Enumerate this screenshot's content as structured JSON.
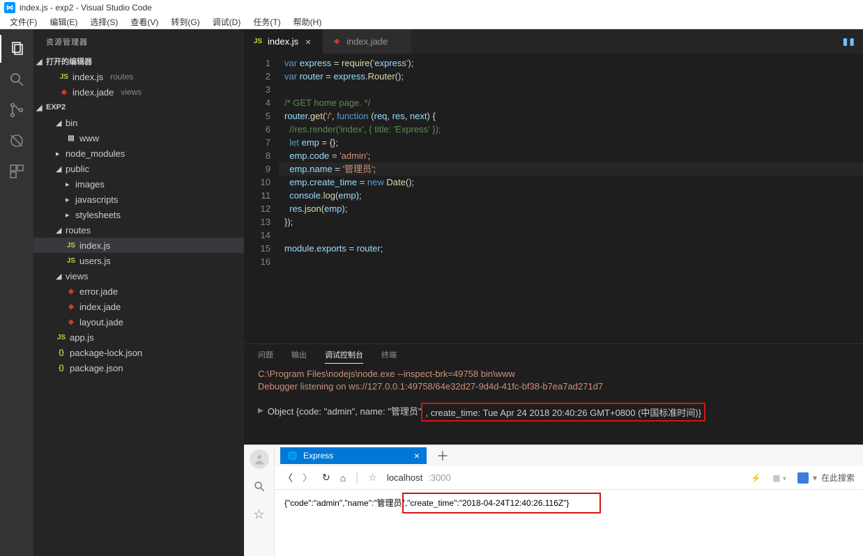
{
  "titlebar": {
    "title": "index.js - exp2 - Visual Studio Code"
  },
  "menubar": {
    "file": "文件(F)",
    "edit": "编辑(E)",
    "selection": "选择(S)",
    "view": "查看(V)",
    "goto": "转到(G)",
    "debug": "调试(D)",
    "tasks": "任务(T)",
    "help": "帮助(H)"
  },
  "sidebar": {
    "title": "资源管理器",
    "openEditorsLabel": "打开的编辑器",
    "openEditors": [
      {
        "name": "index.js",
        "hint": "routes",
        "icon": "JS",
        "iconClass": "js-icon"
      },
      {
        "name": "index.jade",
        "hint": "views",
        "icon": "◆",
        "iconClass": "jade-icon"
      }
    ],
    "projectName": "EXP2",
    "tree": [
      {
        "indent": 14,
        "kind": "folder",
        "name": "bin",
        "expanded": true
      },
      {
        "indent": 28,
        "kind": "file",
        "name": "www",
        "icon": "▤"
      },
      {
        "indent": 14,
        "kind": "folder",
        "name": "node_modules",
        "expanded": false
      },
      {
        "indent": 14,
        "kind": "folder",
        "name": "public",
        "expanded": true
      },
      {
        "indent": 28,
        "kind": "folder",
        "name": "images",
        "expanded": false
      },
      {
        "indent": 28,
        "kind": "folder",
        "name": "javascripts",
        "expanded": false
      },
      {
        "indent": 28,
        "kind": "folder",
        "name": "stylesheets",
        "expanded": false
      },
      {
        "indent": 14,
        "kind": "folder",
        "name": "routes",
        "expanded": true
      },
      {
        "indent": 28,
        "kind": "file",
        "name": "index.js",
        "icon": "JS",
        "iconClass": "js-icon",
        "selected": true
      },
      {
        "indent": 28,
        "kind": "file",
        "name": "users.js",
        "icon": "JS",
        "iconClass": "js-icon"
      },
      {
        "indent": 14,
        "kind": "folder",
        "name": "views",
        "expanded": true
      },
      {
        "indent": 28,
        "kind": "file",
        "name": "error.jade",
        "icon": "◆",
        "iconClass": "jade-icon"
      },
      {
        "indent": 28,
        "kind": "file",
        "name": "index.jade",
        "icon": "◆",
        "iconClass": "jade-icon"
      },
      {
        "indent": 28,
        "kind": "file",
        "name": "layout.jade",
        "icon": "◆",
        "iconClass": "jade-icon"
      },
      {
        "indent": 14,
        "kind": "file",
        "name": "app.js",
        "icon": "JS",
        "iconClass": "js-icon"
      },
      {
        "indent": 14,
        "kind": "file",
        "name": "package-lock.json",
        "icon": "{}",
        "iconClass": "json-icon"
      },
      {
        "indent": 14,
        "kind": "file",
        "name": "package.json",
        "icon": "{}",
        "iconClass": "json-icon"
      }
    ]
  },
  "editor": {
    "tabs": [
      {
        "name": "index.js",
        "icon": "JS",
        "iconClass": "js-icon",
        "active": true
      },
      {
        "name": "index.jade",
        "icon": "◆",
        "iconClass": "jade-icon",
        "active": false
      }
    ],
    "lineNumbers": [
      "1",
      "2",
      "3",
      "4",
      "5",
      "6",
      "7",
      "8",
      "9",
      "10",
      "11",
      "12",
      "13",
      "14",
      "15",
      "16"
    ],
    "code": [
      "var express = require('express');",
      "var router = express.Router();",
      "",
      "/* GET home page. */",
      "router.get('/', function (req, res, next) {",
      "  //res.render('index', { title: 'Express' });",
      "  let emp = {};",
      "  emp.code = 'admin';",
      "  emp.name = '管理员';",
      "  emp.create_time = new Date();",
      "  console.log(emp);",
      "  res.json(emp);",
      "});",
      "",
      "module.exports = router;",
      ""
    ]
  },
  "panel": {
    "tabs": {
      "problems": "问题",
      "output": "输出",
      "debug": "调试控制台",
      "terminal": "终端"
    },
    "line1": "C:\\Program Files\\nodejs\\node.exe --inspect-brk=49758 bin\\www",
    "line2": "Debugger listening on ws://127.0.0.1:49758/64e32d27-9d4d-41fc-bf38-b7ea7ad271d7",
    "objectPrefix": "Object {code: \"admin\", name: \"管理员\"",
    "objectBoxed": ", create_time: Tue Apr 24 2018 20:40:26 GMT+0800 (中国标准时间)}"
  },
  "browser": {
    "tabTitle": "Express",
    "addressHost": "localhost",
    "addressPort": ":3000",
    "searchPlaceholder": "在此搜索",
    "bodyPrefix": "{\"code\":\"admin\",\"name\":\"管理员\"",
    "bodyBoxed": ",\"create_time\":\"2018-04-24T12:40:26.116Z\"}"
  }
}
